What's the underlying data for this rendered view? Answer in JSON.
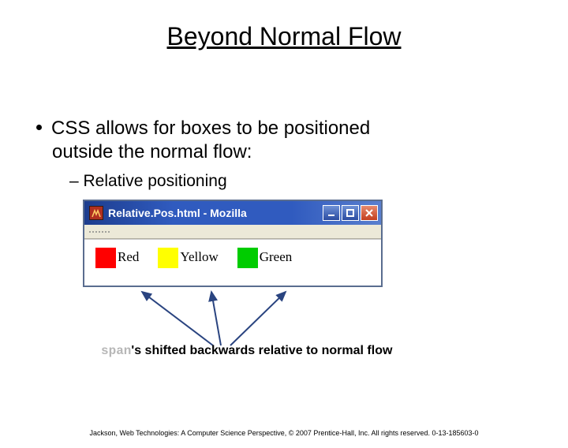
{
  "title": "Beyond Normal Flow",
  "bullet": {
    "line1": "CSS allows for boxes to be positioned",
    "line2": "outside the normal flow:"
  },
  "sub_bullet": "Relative positioning",
  "window": {
    "title": "Relative.Pos.html - Mozilla",
    "labels": {
      "red": "Red",
      "yellow": "Yellow",
      "green": "Green"
    },
    "colors": {
      "red": "#ff0000",
      "yellow": "#ffff00",
      "green": "#00cc00"
    }
  },
  "caption": {
    "code": "span",
    "rest": "'s shifted backwards relative to normal flow"
  },
  "footer": "Jackson, Web Technologies: A Computer Science Perspective, © 2007 Prentice-Hall, Inc. All rights reserved. 0-13-185603-0"
}
